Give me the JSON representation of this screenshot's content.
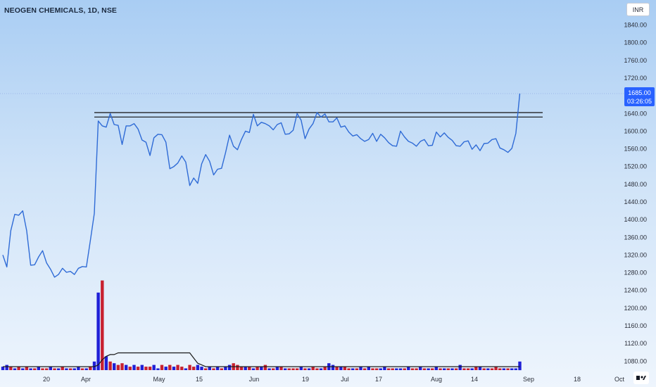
{
  "header": {
    "title": "NEOGEN CHEMICALS, 1D, NSE"
  },
  "toolbar": {
    "currency_label": "INR"
  },
  "last_price": {
    "price": "1685.00",
    "countdown": "03:26:05"
  },
  "colors": {
    "line": "#2f6bd6",
    "vol_up": "#1f1fd6",
    "vol_down": "#c8202f",
    "resistance": "#111111",
    "label_bg": "#2962ff"
  },
  "chart_data": {
    "type": "line",
    "title": "NEOGEN CHEMICALS, 1D, NSE",
    "currency": "INR",
    "ylim": [
      1040,
      1880
    ],
    "y_ticks": [
      1840,
      1800,
      1760,
      1720,
      1680,
      1640,
      1600,
      1560,
      1520,
      1480,
      1440,
      1400,
      1360,
      1320,
      1280,
      1240,
      1200,
      1160,
      1120,
      1080
    ],
    "x_tick_labels": [
      "20",
      "Apr",
      "May",
      "15",
      "Jun",
      "19",
      "Jul",
      "17",
      "Aug",
      "14",
      "Sep",
      "18",
      "Oct"
    ],
    "grid": false,
    "series": [
      {
        "name": "",
        "values": [
          1320,
          1293,
          1375,
          1412,
          1410,
          1420,
          1375,
          1297,
          1298,
          1316,
          1330,
          1302,
          1288,
          1270,
          1276,
          1290,
          1281,
          1283,
          1276,
          1290,
          1294,
          1293,
          1352,
          1414,
          1623,
          1612,
          1609,
          1640,
          1615,
          1613,
          1570,
          1612,
          1612,
          1617,
          1605,
          1580,
          1575,
          1545,
          1585,
          1593,
          1592,
          1575,
          1515,
          1520,
          1528,
          1544,
          1530,
          1477,
          1494,
          1482,
          1526,
          1547,
          1532,
          1501,
          1514,
          1516,
          1551,
          1591,
          1566,
          1558,
          1581,
          1600,
          1597,
          1638,
          1612,
          1620,
          1617,
          1612,
          1603,
          1615,
          1619,
          1593,
          1594,
          1602,
          1640,
          1625,
          1583,
          1605,
          1617,
          1642,
          1632,
          1639,
          1621,
          1621,
          1630,
          1609,
          1612,
          1598,
          1589,
          1592,
          1583,
          1577,
          1581,
          1595,
          1577,
          1593,
          1585,
          1574,
          1567,
          1566,
          1600,
          1587,
          1577,
          1573,
          1566,
          1577,
          1581,
          1567,
          1568,
          1598,
          1587,
          1596,
          1586,
          1579,
          1567,
          1566,
          1576,
          1578,
          1559,
          1569,
          1556,
          1572,
          1573,
          1581,
          1583,
          1562,
          1558,
          1552,
          1561,
          1595,
          1685
        ]
      }
    ],
    "resistance_levels": [
      1642,
      1632
    ],
    "volume": {
      "values": [
        2,
        3,
        2,
        1,
        2,
        1,
        2,
        1,
        1,
        2,
        1,
        1,
        2,
        1,
        1,
        2,
        1,
        1,
        1,
        2,
        1,
        1,
        2,
        5,
        45,
        52,
        8,
        5,
        4,
        3,
        4,
        3,
        2,
        3,
        2,
        3,
        2,
        2,
        3,
        1,
        3,
        2,
        3,
        2,
        3,
        2,
        1,
        3,
        2,
        3,
        2,
        1,
        2,
        1,
        2,
        1,
        2,
        3,
        4,
        3,
        2,
        2,
        2,
        1,
        2,
        2,
        3,
        1,
        1,
        2,
        2,
        1,
        1,
        1,
        1,
        2,
        1,
        1,
        2,
        1,
        1,
        2,
        4,
        3,
        2,
        2,
        2,
        1,
        1,
        1,
        2,
        1,
        2,
        1,
        1,
        1,
        2,
        1,
        1,
        1,
        1,
        1,
        2,
        1,
        1,
        2,
        1,
        1,
        1,
        2,
        1,
        1,
        1,
        1,
        1,
        3,
        1,
        1,
        1,
        2,
        2,
        1,
        1,
        1,
        2,
        1,
        1,
        1,
        1,
        1,
        5
      ],
      "directions": [
        "u",
        "u",
        "d",
        "u",
        "d",
        "u",
        "d",
        "u",
        "d",
        "u",
        "d",
        "d",
        "u",
        "d",
        "u",
        "d",
        "u",
        "d",
        "u",
        "u",
        "d",
        "u",
        "d",
        "u",
        "u",
        "d",
        "u",
        "d",
        "u",
        "d",
        "d",
        "u",
        "d",
        "u",
        "d",
        "u",
        "d",
        "d",
        "u",
        "u",
        "d",
        "u",
        "d",
        "u",
        "d",
        "d",
        "u",
        "d",
        "d",
        "u",
        "u",
        "d",
        "u",
        "d",
        "u",
        "d",
        "u",
        "u",
        "d",
        "d",
        "d",
        "u",
        "d",
        "u",
        "d",
        "u",
        "d",
        "u",
        "d",
        "u",
        "d",
        "u",
        "d",
        "d",
        "d",
        "u",
        "d",
        "u",
        "d",
        "d",
        "u",
        "d",
        "u",
        "u",
        "d",
        "u",
        "d",
        "d",
        "u",
        "d",
        "u",
        "d",
        "u",
        "d",
        "d",
        "u",
        "u",
        "d",
        "d",
        "u",
        "u",
        "d",
        "u",
        "d",
        "d",
        "u",
        "d",
        "u",
        "d",
        "u",
        "d",
        "u",
        "d",
        "u",
        "d",
        "u",
        "d",
        "d",
        "u",
        "d",
        "u",
        "d",
        "u",
        "d",
        "d",
        "d",
        "u",
        "d",
        "u",
        "u",
        "u"
      ],
      "ma": [
        2,
        2,
        2,
        2,
        2,
        2,
        2,
        2,
        2,
        2,
        2,
        2,
        2,
        2,
        2,
        2,
        2,
        2,
        2,
        2,
        2,
        2,
        2,
        2,
        3,
        6,
        8,
        9,
        9,
        10,
        10,
        10,
        10,
        10,
        10,
        10,
        10,
        10,
        10,
        10,
        10,
        10,
        10,
        10,
        10,
        10,
        10,
        10,
        7,
        4,
        3,
        2,
        2,
        2,
        2,
        2,
        2,
        2,
        2,
        2,
        2,
        2,
        2,
        2,
        2,
        2,
        2,
        2,
        2,
        2,
        2,
        2,
        2,
        2,
        2,
        2,
        2,
        2,
        2,
        2,
        2,
        2,
        2,
        2,
        2,
        2,
        2,
        2,
        2,
        2,
        2,
        2,
        2,
        2,
        2,
        2,
        2,
        2,
        2,
        2,
        2,
        2,
        2,
        2,
        2,
        2,
        2,
        2,
        2,
        2,
        2,
        2,
        2,
        2,
        2,
        2,
        2,
        2,
        2,
        2,
        2,
        2,
        2,
        2,
        2,
        2,
        2,
        2,
        2,
        2,
        2
      ]
    }
  }
}
